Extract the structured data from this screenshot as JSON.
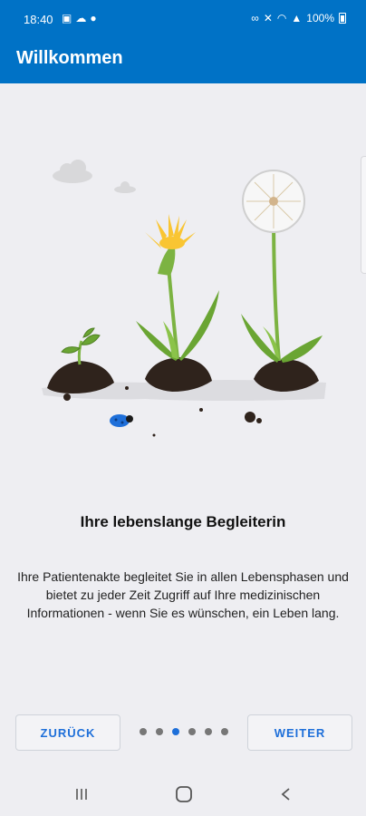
{
  "status_bar": {
    "time": "18:40",
    "battery": "100%"
  },
  "app_bar": {
    "title": "Willkommen"
  },
  "content": {
    "headline": "Ihre lebenslange Begleiterin",
    "body": "Ihre Patientenakte begleitet Sie in allen Lebensphasen und bietet zu jeder Zeit Zugriff auf Ihre medizinischen Informationen - wenn Sie es wünschen, ein Leben lang."
  },
  "navigation": {
    "back_label": "ZURÜCK",
    "next_label": "WEITER",
    "page_count": 6,
    "current_page": 3
  },
  "colors": {
    "primary": "#0072c6",
    "accent": "#1e6fd9",
    "background": "#eeeef2"
  },
  "icons": [
    "photo-icon",
    "cloud-icon",
    "lightbulb-icon",
    "link-icon",
    "mute-icon",
    "wifi-icon",
    "signal-icon",
    "battery-icon",
    "recent-apps-icon",
    "home-icon",
    "back-icon"
  ]
}
